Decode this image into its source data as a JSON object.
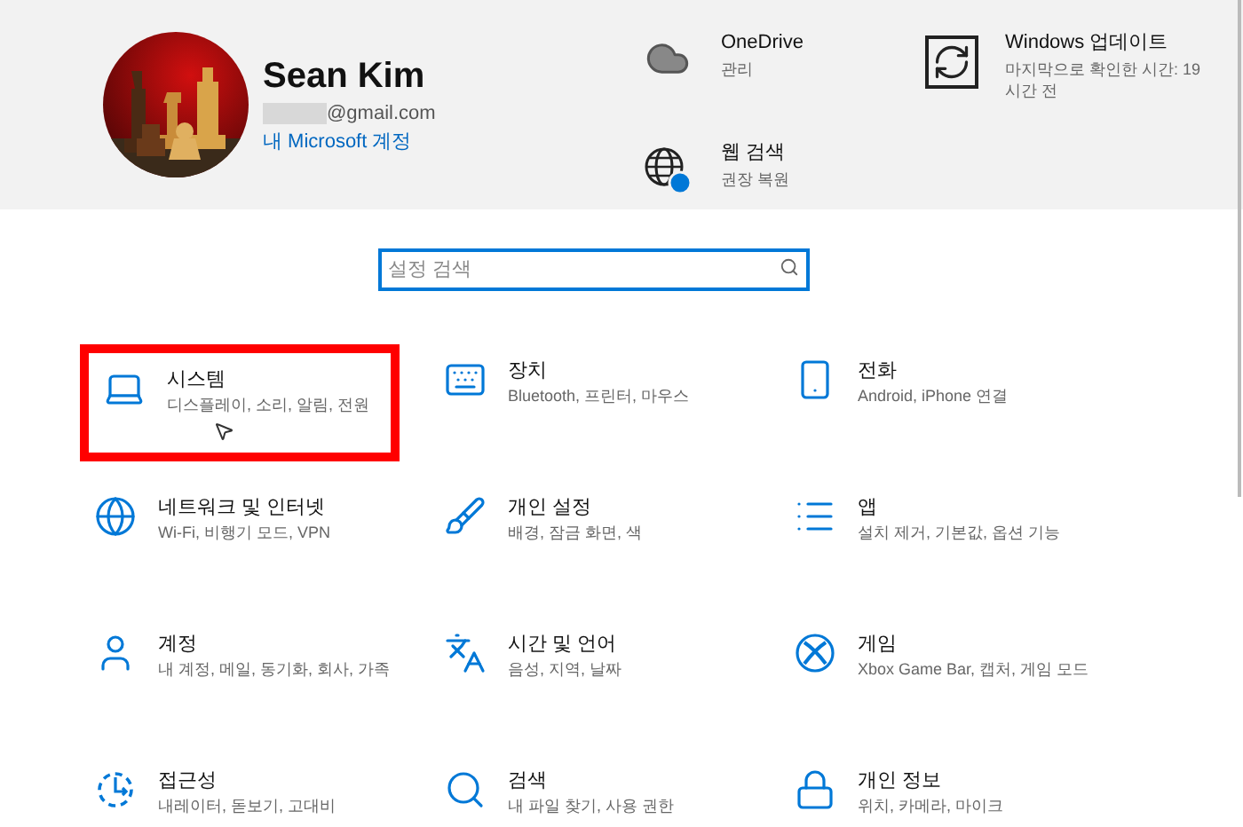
{
  "account": {
    "name": "Sean Kim",
    "email": "@gmail.com",
    "link": "내 Microsoft 계정"
  },
  "quick_links": [
    {
      "kind": "onedrive",
      "title": "OneDrive",
      "subtitle": "관리"
    },
    {
      "kind": "update",
      "title": "Windows 업데이트",
      "subtitle": "마지막으로 확인한 시간: 19시간 전"
    },
    {
      "kind": "web",
      "title": "웹 검색",
      "subtitle": "권장 복원"
    }
  ],
  "search": {
    "placeholder": "설정 검색"
  },
  "categories": [
    {
      "kind": "system",
      "title": "시스템",
      "description": "디스플레이, 소리, 알림, 전원",
      "highlighted": true
    },
    {
      "kind": "devices",
      "title": "장치",
      "description": "Bluetooth, 프린터, 마우스",
      "highlighted": false
    },
    {
      "kind": "phone",
      "title": "전화",
      "description": "Android, iPhone 연결",
      "highlighted": false
    },
    {
      "kind": "network",
      "title": "네트워크 및 인터넷",
      "description": "Wi-Fi, 비행기 모드, VPN",
      "highlighted": false
    },
    {
      "kind": "personalize",
      "title": "개인 설정",
      "description": "배경, 잠금 화면, 색",
      "highlighted": false
    },
    {
      "kind": "apps",
      "title": "앱",
      "description": "설치 제거, 기본값, 옵션 기능",
      "highlighted": false
    },
    {
      "kind": "accounts",
      "title": "계정",
      "description": "내 계정, 메일, 동기화, 회사, 가족",
      "highlighted": false
    },
    {
      "kind": "time",
      "title": "시간 및 언어",
      "description": "음성, 지역, 날짜",
      "highlighted": false
    },
    {
      "kind": "gaming",
      "title": "게임",
      "description": "Xbox Game Bar, 캡처, 게임 모드",
      "highlighted": false
    },
    {
      "kind": "ease",
      "title": "접근성",
      "description": "내레이터, 돋보기, 고대비",
      "highlighted": false
    },
    {
      "kind": "search",
      "title": "검색",
      "description": "내 파일 찾기, 사용 권한",
      "highlighted": false
    },
    {
      "kind": "privacy",
      "title": "개인 정보",
      "description": "위치, 카메라, 마이크",
      "highlighted": false
    }
  ]
}
